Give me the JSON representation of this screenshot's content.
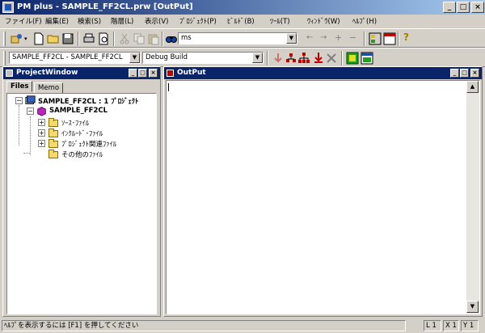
{
  "window": {
    "title": "PM plus - SAMPLE_FF2CL.prw [OutPut]",
    "minimize_glyph": "_",
    "maximize_glyph": "□",
    "close_glyph": "×"
  },
  "menu": [
    {
      "label": "ファイル(F)"
    },
    {
      "label": "編集(E)"
    },
    {
      "label": "検索(S)"
    },
    {
      "label": "階層(L)"
    },
    {
      "label": "表示(V)"
    },
    {
      "label": "ﾌﾟﾛｼﾞｪｸﾄ(P)"
    },
    {
      "label": "ﾋﾞﾙﾄﾞ(B)"
    },
    {
      "label": "ﾂｰﾙ(T)"
    },
    {
      "label": "ｳｨﾝﾄﾞｳ(W)"
    },
    {
      "label": "ﾍﾙﾌﾟ(H)"
    }
  ],
  "toolbar1": {
    "search_value": "ms",
    "icons": [
      "new-project-icon",
      "new-file-icon",
      "open-icon",
      "save-icon",
      "print-icon",
      "print-preview-icon",
      "cut-icon",
      "copy-icon",
      "paste-icon",
      "find-icon",
      "back-icon",
      "forward-icon",
      "add-icon",
      "remove-icon",
      "project-window-icon",
      "output-window-icon",
      "help-icon"
    ]
  },
  "toolbar2": {
    "project_combo": "SAMPLE_FF2CL - SAMPLE_FF2CL",
    "build_combo": "Debug Build",
    "icons": [
      "compile-icon",
      "build-icon",
      "rebuild-icon",
      "build-down-icon",
      "stop-build-icon",
      "debug-icon",
      "debug-window-icon"
    ]
  },
  "project_window": {
    "title": "ProjectWindow",
    "tabs": [
      "Files",
      "Memo"
    ],
    "root_label": "SAMPLE_FF2CL : 1 ﾌﾟﾛｼﾞｪｸﾄ",
    "project_label": "SAMPLE_FF2CL",
    "folders": [
      {
        "label": "ｿｰｽ･ﾌｧｲﾙ",
        "expander": "+"
      },
      {
        "label": "ｲﾝｸﾙｰﾄﾞ･ﾌｧｲﾙ",
        "expander": "+"
      },
      {
        "label": "ﾌﾟﾛｼﾞｪｸﾄ関連ﾌｧｲﾙ",
        "expander": "+"
      },
      {
        "label": "その他のﾌｧｲﾙ",
        "expander": ""
      }
    ]
  },
  "output_window": {
    "title": "OutPut",
    "content": ""
  },
  "statusbar": {
    "message": "ﾍﾙﾌﾟを表示するには [F1] を押してください",
    "line": "L 1",
    "col": "X 1",
    "row": "Y 1"
  },
  "colors": {
    "face": "#d4d0c8",
    "title_active": "#0a246a",
    "title_gradient_end": "#a6caf0"
  }
}
